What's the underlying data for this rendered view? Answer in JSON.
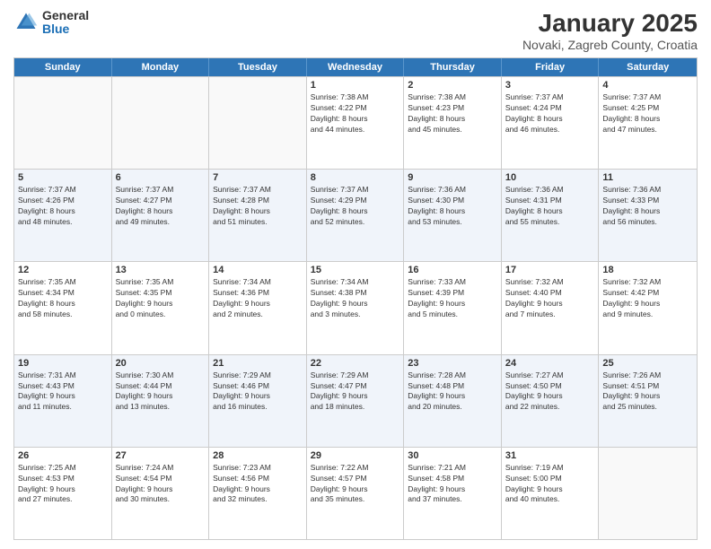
{
  "header": {
    "logo_general": "General",
    "logo_blue": "Blue",
    "month": "January 2025",
    "location": "Novaki, Zagreb County, Croatia"
  },
  "weekdays": [
    "Sunday",
    "Monday",
    "Tuesday",
    "Wednesday",
    "Thursday",
    "Friday",
    "Saturday"
  ],
  "weeks": [
    [
      {
        "day": "",
        "info": ""
      },
      {
        "day": "",
        "info": ""
      },
      {
        "day": "",
        "info": ""
      },
      {
        "day": "1",
        "info": "Sunrise: 7:38 AM\nSunset: 4:22 PM\nDaylight: 8 hours\nand 44 minutes."
      },
      {
        "day": "2",
        "info": "Sunrise: 7:38 AM\nSunset: 4:23 PM\nDaylight: 8 hours\nand 45 minutes."
      },
      {
        "day": "3",
        "info": "Sunrise: 7:37 AM\nSunset: 4:24 PM\nDaylight: 8 hours\nand 46 minutes."
      },
      {
        "day": "4",
        "info": "Sunrise: 7:37 AM\nSunset: 4:25 PM\nDaylight: 8 hours\nand 47 minutes."
      }
    ],
    [
      {
        "day": "5",
        "info": "Sunrise: 7:37 AM\nSunset: 4:26 PM\nDaylight: 8 hours\nand 48 minutes."
      },
      {
        "day": "6",
        "info": "Sunrise: 7:37 AM\nSunset: 4:27 PM\nDaylight: 8 hours\nand 49 minutes."
      },
      {
        "day": "7",
        "info": "Sunrise: 7:37 AM\nSunset: 4:28 PM\nDaylight: 8 hours\nand 51 minutes."
      },
      {
        "day": "8",
        "info": "Sunrise: 7:37 AM\nSunset: 4:29 PM\nDaylight: 8 hours\nand 52 minutes."
      },
      {
        "day": "9",
        "info": "Sunrise: 7:36 AM\nSunset: 4:30 PM\nDaylight: 8 hours\nand 53 minutes."
      },
      {
        "day": "10",
        "info": "Sunrise: 7:36 AM\nSunset: 4:31 PM\nDaylight: 8 hours\nand 55 minutes."
      },
      {
        "day": "11",
        "info": "Sunrise: 7:36 AM\nSunset: 4:33 PM\nDaylight: 8 hours\nand 56 minutes."
      }
    ],
    [
      {
        "day": "12",
        "info": "Sunrise: 7:35 AM\nSunset: 4:34 PM\nDaylight: 8 hours\nand 58 minutes."
      },
      {
        "day": "13",
        "info": "Sunrise: 7:35 AM\nSunset: 4:35 PM\nDaylight: 9 hours\nand 0 minutes."
      },
      {
        "day": "14",
        "info": "Sunrise: 7:34 AM\nSunset: 4:36 PM\nDaylight: 9 hours\nand 2 minutes."
      },
      {
        "day": "15",
        "info": "Sunrise: 7:34 AM\nSunset: 4:38 PM\nDaylight: 9 hours\nand 3 minutes."
      },
      {
        "day": "16",
        "info": "Sunrise: 7:33 AM\nSunset: 4:39 PM\nDaylight: 9 hours\nand 5 minutes."
      },
      {
        "day": "17",
        "info": "Sunrise: 7:32 AM\nSunset: 4:40 PM\nDaylight: 9 hours\nand 7 minutes."
      },
      {
        "day": "18",
        "info": "Sunrise: 7:32 AM\nSunset: 4:42 PM\nDaylight: 9 hours\nand 9 minutes."
      }
    ],
    [
      {
        "day": "19",
        "info": "Sunrise: 7:31 AM\nSunset: 4:43 PM\nDaylight: 9 hours\nand 11 minutes."
      },
      {
        "day": "20",
        "info": "Sunrise: 7:30 AM\nSunset: 4:44 PM\nDaylight: 9 hours\nand 13 minutes."
      },
      {
        "day": "21",
        "info": "Sunrise: 7:29 AM\nSunset: 4:46 PM\nDaylight: 9 hours\nand 16 minutes."
      },
      {
        "day": "22",
        "info": "Sunrise: 7:29 AM\nSunset: 4:47 PM\nDaylight: 9 hours\nand 18 minutes."
      },
      {
        "day": "23",
        "info": "Sunrise: 7:28 AM\nSunset: 4:48 PM\nDaylight: 9 hours\nand 20 minutes."
      },
      {
        "day": "24",
        "info": "Sunrise: 7:27 AM\nSunset: 4:50 PM\nDaylight: 9 hours\nand 22 minutes."
      },
      {
        "day": "25",
        "info": "Sunrise: 7:26 AM\nSunset: 4:51 PM\nDaylight: 9 hours\nand 25 minutes."
      }
    ],
    [
      {
        "day": "26",
        "info": "Sunrise: 7:25 AM\nSunset: 4:53 PM\nDaylight: 9 hours\nand 27 minutes."
      },
      {
        "day": "27",
        "info": "Sunrise: 7:24 AM\nSunset: 4:54 PM\nDaylight: 9 hours\nand 30 minutes."
      },
      {
        "day": "28",
        "info": "Sunrise: 7:23 AM\nSunset: 4:56 PM\nDaylight: 9 hours\nand 32 minutes."
      },
      {
        "day": "29",
        "info": "Sunrise: 7:22 AM\nSunset: 4:57 PM\nDaylight: 9 hours\nand 35 minutes."
      },
      {
        "day": "30",
        "info": "Sunrise: 7:21 AM\nSunset: 4:58 PM\nDaylight: 9 hours\nand 37 minutes."
      },
      {
        "day": "31",
        "info": "Sunrise: 7:19 AM\nSunset: 5:00 PM\nDaylight: 9 hours\nand 40 minutes."
      },
      {
        "day": "",
        "info": ""
      }
    ]
  ]
}
